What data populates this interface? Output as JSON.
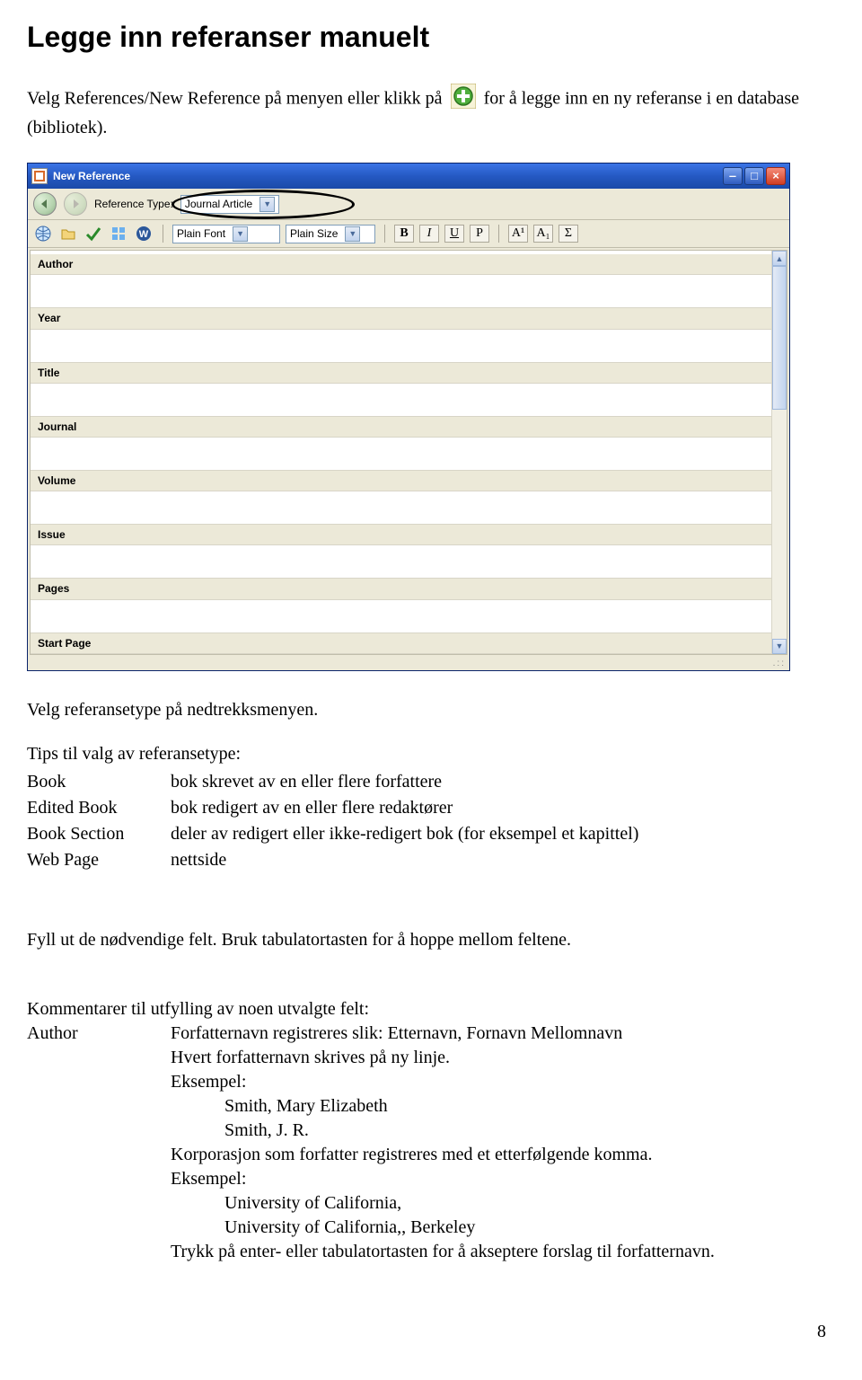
{
  "pageTitle": "Legge inn referanser manuelt",
  "intro": {
    "text1": "Velg References/New Reference på menyen eller klikk på ",
    "text2": " for å legge inn en ny referanse i en database (bibliotek)."
  },
  "window": {
    "title": "New Reference",
    "refTypeLabel": "Reference Type:",
    "refTypeValue": "Journal Article",
    "plainFont": "Plain Font",
    "plainSize": "Plain Size",
    "fmt": {
      "bold": "B",
      "italic": "I",
      "underline": "U",
      "p": "P",
      "sup": "A¹",
      "sub": "A₁",
      "sigma": "Σ"
    },
    "fields": [
      "Author",
      "Year",
      "Title",
      "Journal",
      "Volume",
      "Issue",
      "Pages",
      "Start Page"
    ]
  },
  "afterWindow": "Velg referansetype på nedtrekksmenyen.",
  "tips": {
    "intro": "Tips til valg av referansetype:",
    "rows": [
      {
        "k": "Book",
        "v": "bok skrevet av en eller flere forfattere"
      },
      {
        "k": "Edited Book",
        "v": "bok redigert av en eller flere redaktører"
      },
      {
        "k": "Book Section",
        "v": "deler av redigert eller ikke-redigert bok (for eksempel et kapittel)"
      },
      {
        "k": "Web Page",
        "v": "nettside"
      }
    ]
  },
  "fyllUt": "Fyll ut de nødvendige felt. Bruk tabulatortasten for å hoppe mellom feltene.",
  "comments": {
    "intro": "Kommentarer til utfylling av noen utvalgte felt:",
    "key": "Author",
    "line1": "Forfatternavn registreres slik: Etternavn, Fornavn Mellomnavn",
    "line2": "Hvert forfatternavn skrives på ny linje.",
    "eks1": "Eksempel:",
    "name1": "Smith, Mary Elizabeth",
    "name2": "Smith, J. R.",
    "line3": "Korporasjon som forfatter registreres med et etterfølgende komma.",
    "eks2": "Eksempel:",
    "uni1": "University of California,",
    "uni2": "University of California,, Berkeley",
    "line4": "Trykk på enter- eller tabulatortasten for å akseptere forslag til forfatternavn."
  },
  "pageNumber": "8"
}
